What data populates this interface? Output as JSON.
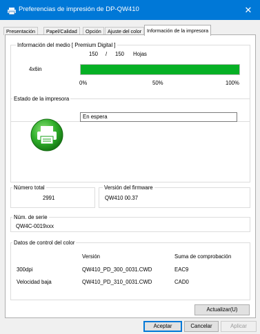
{
  "window": {
    "title": "Preferencias de impresión de DP-QW410",
    "close_glyph": "✕"
  },
  "tabs": [
    {
      "label": "Presentación"
    },
    {
      "label": "Papel/Calidad"
    },
    {
      "label": "Opción"
    },
    {
      "label": "Ajuste del color"
    },
    {
      "label": "Información de la impresora",
      "active": true
    }
  ],
  "media_info": {
    "legend": "Información del medio [ Premium Digital ]",
    "size_label": "4x6in",
    "remaining": "150",
    "separator": "/",
    "total": "150",
    "unit": "Hojas",
    "fill_fraction": 1.0,
    "fill_color": "#06b025",
    "scale": [
      "0%",
      "50%",
      "100%"
    ]
  },
  "printer_status": {
    "legend": "Estado de la impresora",
    "status_text": "En espera",
    "icon": "printer-ready-icon",
    "icon_color": "#1aa01a"
  },
  "total_count": {
    "legend": "Número total",
    "value": "2991"
  },
  "firmware": {
    "legend": "Versión del firmware",
    "value": "QW410 00.37"
  },
  "serial": {
    "legend": "Núm. de serie",
    "value": "QW4C-0019xxx"
  },
  "color_control": {
    "legend": "Datos de control del color",
    "headers": [
      "",
      "Versión",
      "Suma de comprobación"
    ],
    "rows": [
      {
        "name": "300dpi",
        "version": "QW410_PD_300_0031.CWD",
        "checksum": "EAC9"
      },
      {
        "name": "Velocidad baja",
        "version": "QW410_PD_310_0031.CWD",
        "checksum": "CAD0"
      }
    ]
  },
  "buttons": {
    "update": "Actualizar(U)",
    "accept": "Aceptar",
    "cancel": "Cancelar",
    "apply": "Aplicar"
  },
  "colors": {
    "titlebar": "#0078d7",
    "progress": "#06b025"
  }
}
